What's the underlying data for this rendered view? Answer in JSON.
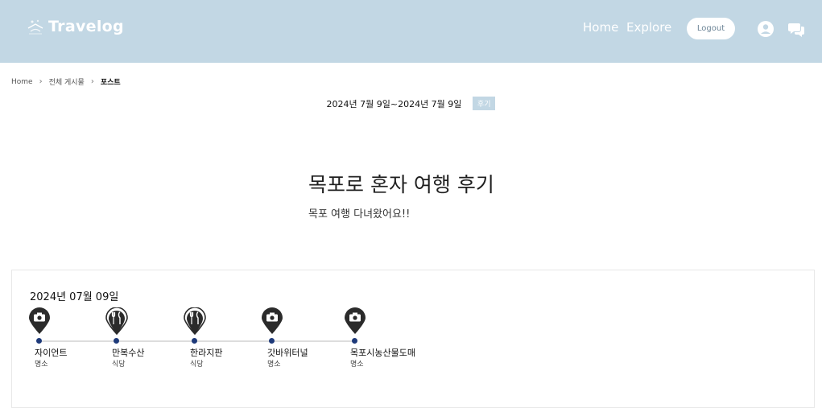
{
  "header": {
    "brand": "Travelog",
    "nav": {
      "home": "Home",
      "explore": "Explore"
    },
    "logout_label": "Logout",
    "colors": {
      "bar": "#c2d7e4",
      "text": "#ffffff"
    },
    "icons": [
      "user-icon",
      "chat-icon"
    ]
  },
  "breadcrumb": {
    "items": [
      "Home",
      "전체 게시물",
      "포스트"
    ]
  },
  "post": {
    "date_range": "2024년 7월 9일~2024년 7월 9일",
    "tag": "후기",
    "title": "목포로 혼자 여행 후기",
    "subtitle": "목포 여행 다녀왔어요!!"
  },
  "itinerary": {
    "day_label": "2024년 07월 09일",
    "stops": [
      {
        "name": "자이언트",
        "category": "명소",
        "icon": "camera-icon"
      },
      {
        "name": "만복수산",
        "category": "식당",
        "icon": "utensils-icon"
      },
      {
        "name": "한라지판",
        "category": "식당",
        "icon": "utensils-icon"
      },
      {
        "name": "갓바위터널",
        "category": "명소",
        "icon": "camera-icon"
      },
      {
        "name": "목포시농산물도매",
        "category": "명소",
        "icon": "camera-icon"
      }
    ],
    "colors": {
      "pin": "#2b2b2b",
      "dot": "#1e3a7a"
    }
  }
}
